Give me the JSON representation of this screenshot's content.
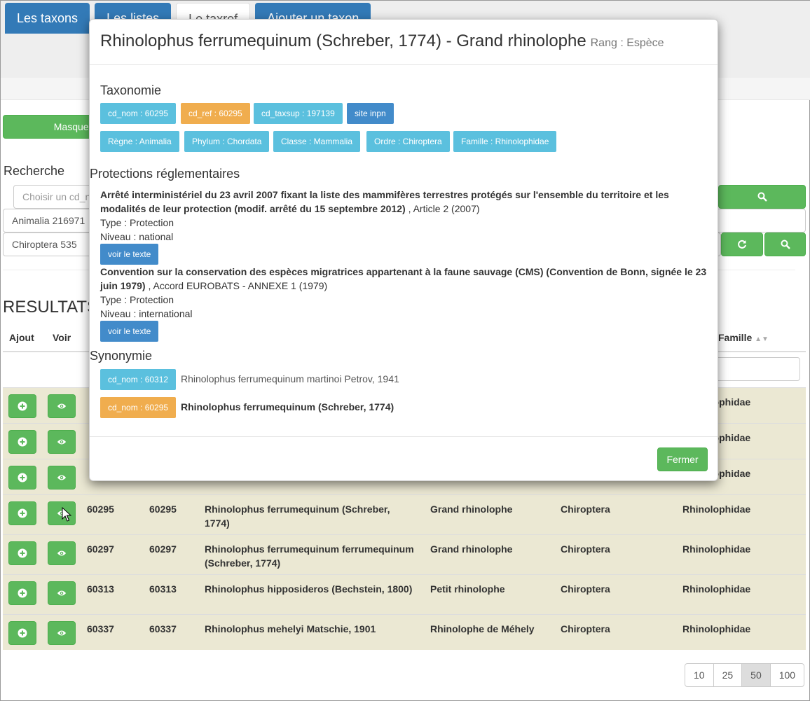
{
  "nav": {
    "tabs": [
      "Les taxons",
      "Les listes",
      "Le taxref",
      "Ajouter un taxon"
    ],
    "active_index": 2
  },
  "search": {
    "mask_button": "Masquer",
    "title": "Recherche",
    "cd_placeholder": "Choisir un cd_n",
    "kingdom_value": "Animalia 216971",
    "order_value": "Chiroptera 535"
  },
  "results": {
    "title": "RESULTATS",
    "columns": [
      "Ajout",
      "Voir",
      "Famille"
    ],
    "rows": [
      {
        "cd_nom": "",
        "cd_ref": "",
        "name": "",
        "common": "",
        "order": "",
        "family": "Rhinolophidae"
      },
      {
        "cd_nom": "",
        "cd_ref": "",
        "name": "",
        "common": "",
        "order": "",
        "family": "Rhinolophidae"
      },
      {
        "cd_nom": "",
        "cd_ref": "",
        "name": "",
        "common": "",
        "order": "",
        "family": "Rhinolophidae"
      },
      {
        "cd_nom": "60295",
        "cd_ref": "60295",
        "name": "Rhinolophus ferrumequinum (Schreber, 1774)",
        "common": "Grand rhinolophe",
        "order": "Chiroptera",
        "family": "Rhinolophidae"
      },
      {
        "cd_nom": "60297",
        "cd_ref": "60297",
        "name": "Rhinolophus ferrumequinum ferrumequinum (Schreber, 1774)",
        "common": "Grand rhinolophe",
        "order": "Chiroptera",
        "family": "Rhinolophidae"
      },
      {
        "cd_nom": "60313",
        "cd_ref": "60313",
        "name": "Rhinolophus hipposideros (Bechstein, 1800)",
        "common": "Petit rhinolophe",
        "order": "Chiroptera",
        "family": "Rhinolophidae"
      },
      {
        "cd_nom": "60337",
        "cd_ref": "60337",
        "name": "Rhinolophus mehelyi Matschie, 1901",
        "common": "Rhinolophe de Méhely",
        "order": "Chiroptera",
        "family": "Rhinolophidae"
      }
    ],
    "page_sizes": [
      "10",
      "25",
      "50",
      "100"
    ],
    "active_page_size": "50"
  },
  "modal": {
    "title": "Rhinolophus ferrumequinum (Schreber, 1774) - Grand rhinolophe",
    "rank": "Rang : Espèce",
    "taxonomy_title": "Taxonomie",
    "ids": {
      "cd_nom": "cd_nom : 60295",
      "cd_ref": "cd_ref : 60295",
      "cd_taxsup": "cd_taxsup : 197139",
      "site": "site inpn"
    },
    "hierarchy": [
      "Règne : Animalia",
      "Phylum : Chordata",
      "Classe : Mammalia",
      "Ordre : Chiroptera",
      "Famille : Rhinolophidae"
    ],
    "protections_title": "Protections réglementaires",
    "protections": [
      {
        "title": "Arrêté interministériel du 23 avril 2007 fixant la liste des mammifères terrestres protégés sur l'ensemble du territoire et les modalités de leur protection (modif. arrêté du 15 septembre 2012)",
        "ref": " , Article 2 (2007)",
        "type": "Type : Protection",
        "level": "Niveau : national",
        "button": "voir le texte"
      },
      {
        "title": "Convention sur la conservation des espèces migratrices appartenant à la faune sauvage (CMS) (Convention de Bonn, signée le 23 juin 1979)",
        "ref": " , Accord EUROBATS - ANNEXE 1 (1979)",
        "type": "Type : Protection",
        "level": "Niveau : international",
        "button": "voir le texte"
      }
    ],
    "synonymy_title": "Synonymie",
    "synonyms": [
      {
        "badge": "cd_nom : 60312",
        "name": "Rhinolophus ferrumequinum martinoi Petrov, 1941",
        "valid": false
      },
      {
        "badge": "cd_nom : 60295",
        "name": "Rhinolophus ferrumequinum (Schreber, 1774)",
        "valid": true
      }
    ],
    "close_button": "Fermer"
  },
  "colors": {
    "primary": "#337ab7",
    "success": "#5cb85c",
    "info": "#5bc0de",
    "warning": "#f0ad4e",
    "row_bg": "#ebe8d3"
  }
}
